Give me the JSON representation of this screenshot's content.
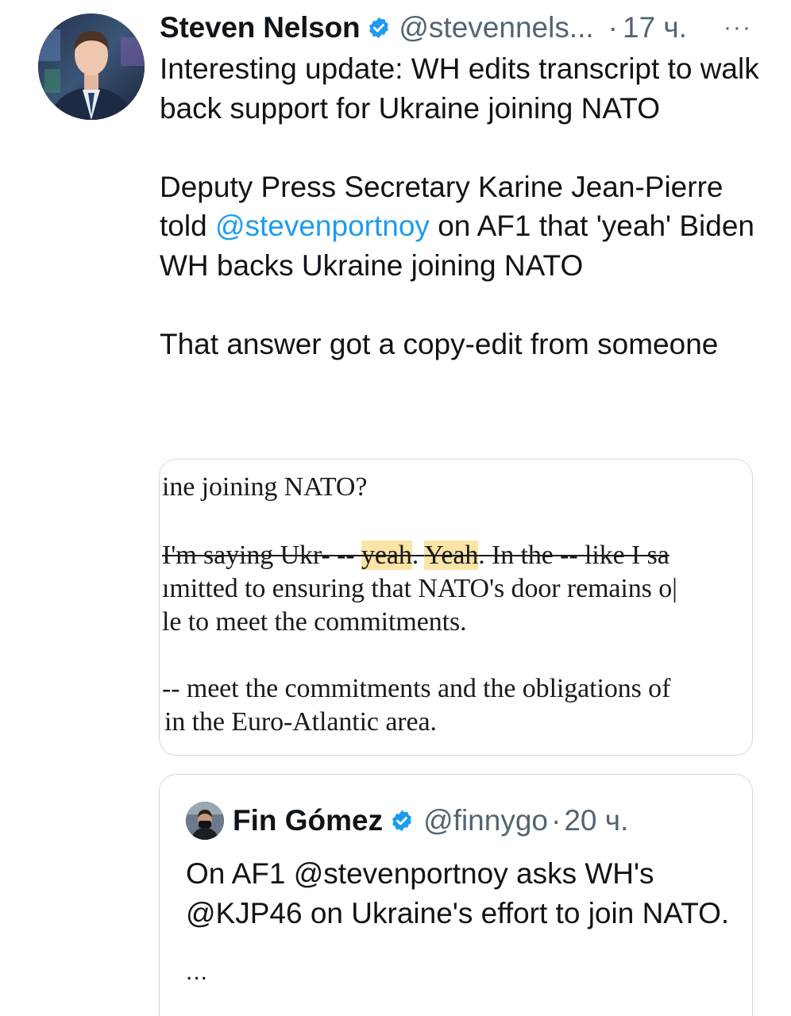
{
  "tweet": {
    "author_name": "Steven Nelson",
    "handle": "@stevennels...",
    "separator": "·",
    "time": "17 ч.",
    "more_icon": "···",
    "text_p1": "Interesting update: WH edits transcript to walk back support for Ukraine joining NATO",
    "text_p2_before": "Deputy Press Secretary Karine Jean-Pierre told ",
    "text_p2_mention": "@stevenportnoy",
    "text_p2_after": " on AF1 that 'yeah' Biden WH backs Ukraine joining NATO",
    "text_p3": "That answer got a copy-edit from someone"
  },
  "media": {
    "line1": "ine joining NATO?",
    "line2_strike_a": "I'm saying Ukr- -- ",
    "line2_hl_1": "yeah",
    "line2_mid": ". ",
    "line2_hl_2": "Yeah",
    "line2_strike_b": ". In the -- like I sa",
    "line3": "ımitted to ensuring that NATO's door remains o|",
    "line4": "le to meet the commitments.",
    "line5": "-- meet the commitments and the obligations of",
    "line6": "in the Euro-Atlantic area."
  },
  "quote": {
    "author_name": "Fin Gómez",
    "handle": "@finnygo",
    "separator": "·",
    "time": "20 ч.",
    "text": "On AF1 @stevenportnoy asks WH's @KJP46 on Ukraine's effort to join NATO.",
    "ellipsis": "..."
  },
  "colors": {
    "accent": "#1d9bf0",
    "secondary_text": "#536471",
    "highlight": "#fbe4a6",
    "border": "#cfd9de"
  }
}
